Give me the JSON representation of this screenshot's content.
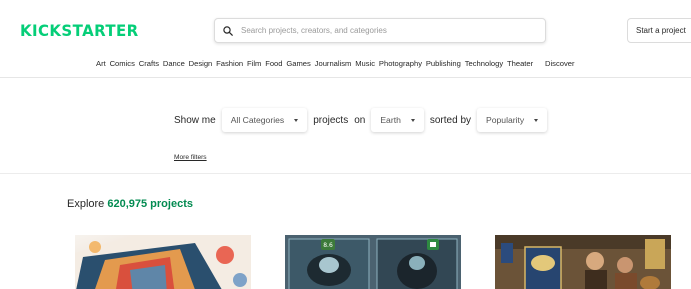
{
  "header": {
    "logo": "KICKSTARTER",
    "search_placeholder": "Search projects, creators, and categories",
    "start_project": "Start a project"
  },
  "categories": [
    "Art",
    "Comics",
    "Crafts",
    "Dance",
    "Design",
    "Fashion",
    "Film",
    "Food",
    "Games",
    "Journalism",
    "Music",
    "Photography",
    "Publishing",
    "Technology",
    "Theater"
  ],
  "discover": "Discover",
  "filters": {
    "show_me": "Show me",
    "category": "All Categories",
    "projects_on": "projects",
    "on": "on",
    "location": "Earth",
    "sorted_by": "sorted by",
    "sort": "Popularity",
    "more_filters": "More filters"
  },
  "explore": {
    "label": "Explore",
    "count": "620,975 projects"
  },
  "cards": [
    {
      "badge": ""
    },
    {
      "badge": "8.6"
    },
    {
      "badge": ""
    }
  ],
  "colors": {
    "brand": "#05ce78",
    "count": "#038b51"
  },
  "icons": [
    "search-icon",
    "caret-down-icon"
  ]
}
